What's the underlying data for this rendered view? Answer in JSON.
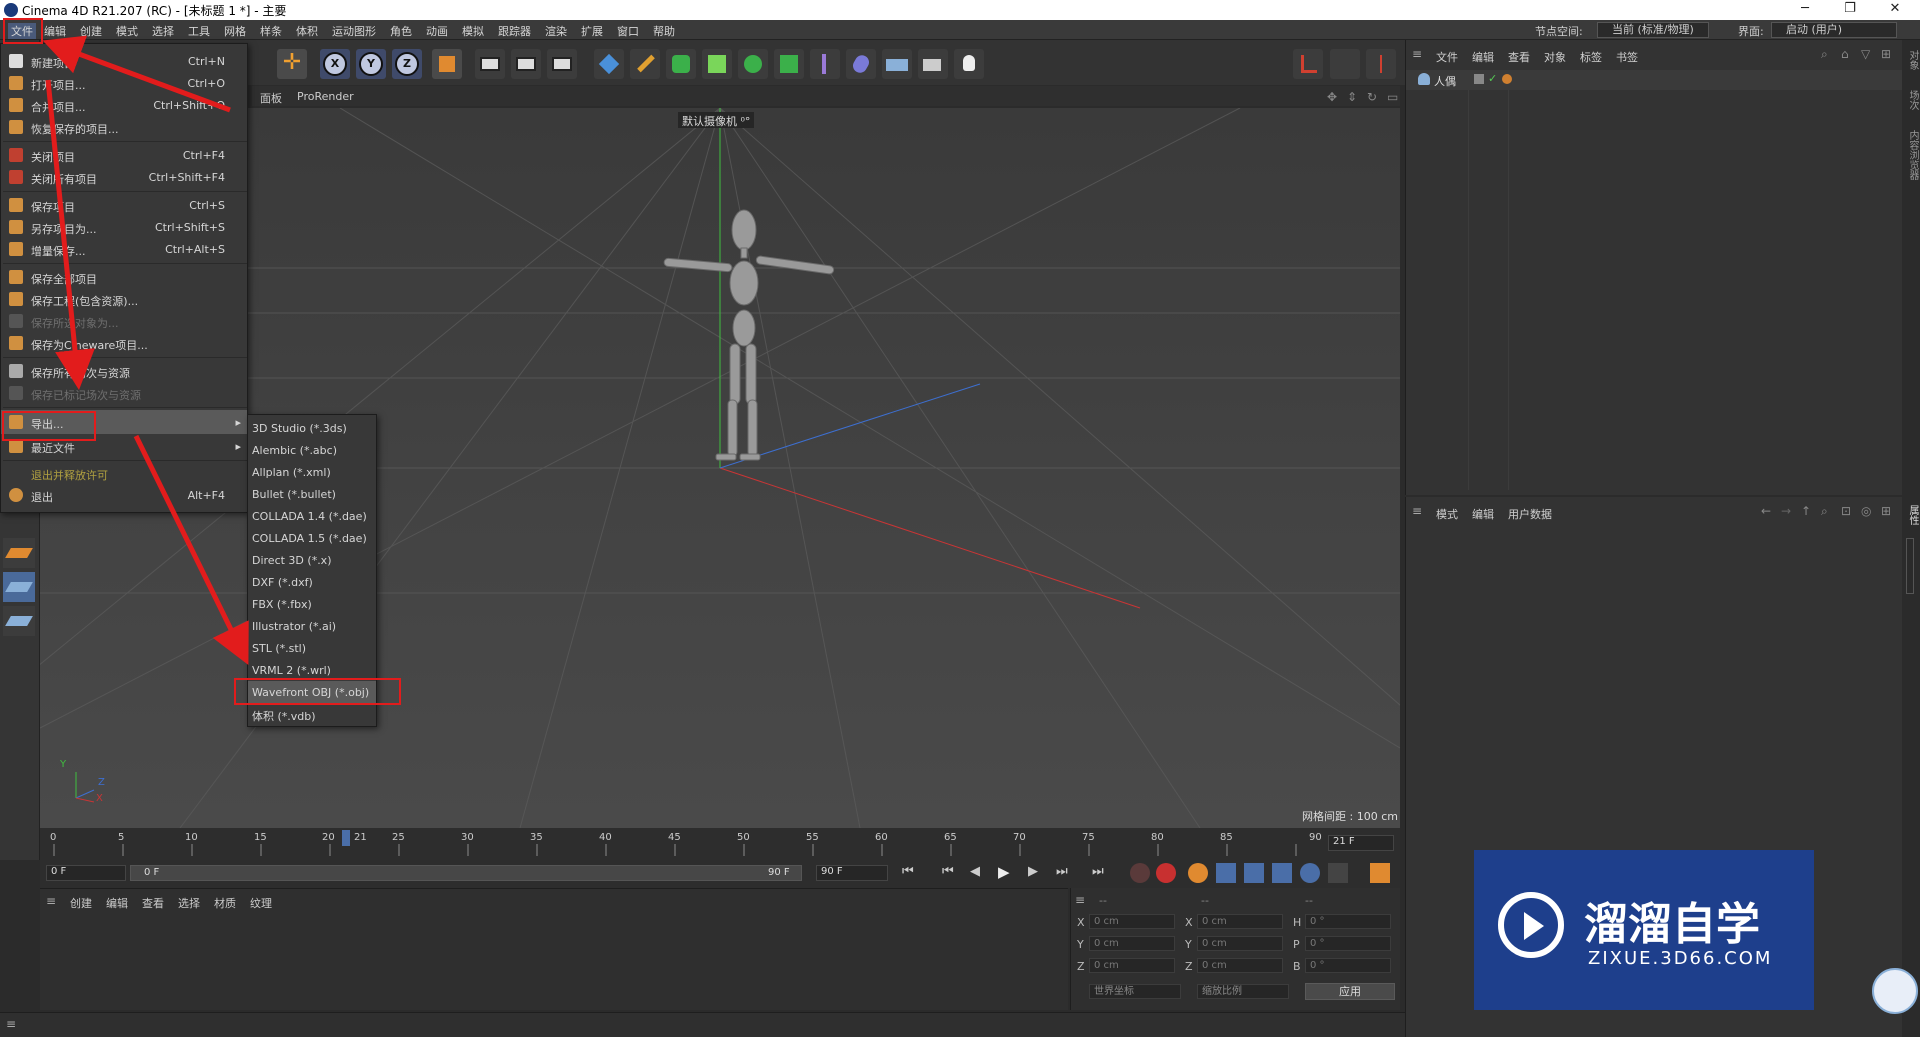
{
  "window": {
    "title": "Cinema 4D R21.207 (RC) - [未标题 1 *] - 主要",
    "controls": [
      "─",
      "❐",
      "✕"
    ]
  },
  "menubar": {
    "items": [
      "文件",
      "编辑",
      "创建",
      "模式",
      "选择",
      "工具",
      "网格",
      "样条",
      "体积",
      "运动图形",
      "角色",
      "动画",
      "模拟",
      "跟踪器",
      "渲染",
      "扩展",
      "窗口",
      "帮助"
    ],
    "node_space_label": "节点空间:",
    "node_space_value": "当前 (标准/物理)",
    "layout_label": "界面:",
    "layout_value": "启动 (用户)"
  },
  "viewport": {
    "menu": [
      "面板",
      "ProRender"
    ],
    "camera_label": "默认摄像机 ⁰°",
    "grid_spacing": "网格间距 : 100 cm"
  },
  "file_menu": {
    "items": [
      {
        "label": "新建项目",
        "shortcut": "Ctrl+N"
      },
      {
        "label": "打开项目...",
        "shortcut": "Ctrl+O"
      },
      {
        "label": "合并项目...",
        "shortcut": "Ctrl+Shift+O"
      },
      {
        "label": "恢复保存的项目...",
        "shortcut": ""
      },
      {
        "label": "关闭项目",
        "shortcut": "Ctrl+F4"
      },
      {
        "label": "关闭所有项目",
        "shortcut": "Ctrl+Shift+F4"
      },
      {
        "label": "保存项目",
        "shortcut": "Ctrl+S"
      },
      {
        "label": "另存项目为...",
        "shortcut": "Ctrl+Shift+S"
      },
      {
        "label": "增量保存...",
        "shortcut": "Ctrl+Alt+S"
      },
      {
        "label": "保存全部项目",
        "shortcut": ""
      },
      {
        "label": "保存工程(包含资源)...",
        "shortcut": ""
      },
      {
        "label": "保存所选对象为...",
        "shortcut": ""
      },
      {
        "label": "保存为Cineware项目...",
        "shortcut": ""
      },
      {
        "label": "保存所有场次与资源",
        "shortcut": ""
      },
      {
        "label": "保存已标记场次与资源",
        "shortcut": ""
      },
      {
        "label": "导出...",
        "shortcut": "▸"
      },
      {
        "label": "最近文件",
        "shortcut": "▸"
      },
      {
        "label": "退出并释放许可",
        "shortcut": ""
      },
      {
        "label": "退出",
        "shortcut": "Alt+F4"
      }
    ]
  },
  "export_menu": {
    "items": [
      "3D Studio (*.3ds)",
      "Alembic (*.abc)",
      "Allplan (*.xml)",
      "Bullet (*.bullet)",
      "COLLADA 1.4 (*.dae)",
      "COLLADA 1.5 (*.dae)",
      "Direct 3D (*.x)",
      "DXF (*.dxf)",
      "FBX (*.fbx)",
      "Illustrator (*.ai)",
      "STL (*.stl)",
      "VRML 2 (*.wrl)",
      "Wavefront OBJ (*.obj)",
      "体积 (*.vdb)"
    ],
    "highlighted": "Wavefront OBJ (*.obj)"
  },
  "timeline": {
    "ticks": [
      "0",
      "5",
      "10",
      "15",
      "20",
      "21",
      "25",
      "30",
      "35",
      "40",
      "45",
      "50",
      "55",
      "60",
      "65",
      "70",
      "75",
      "80",
      "85",
      "90"
    ],
    "current_frame": "21 F",
    "start_field": "0 F",
    "range_start": "0 F",
    "range_end": "90 F",
    "end_field": "90 F"
  },
  "material_manager": {
    "menu": [
      "创建",
      "编辑",
      "查看",
      "选择",
      "材质",
      "纹理"
    ]
  },
  "coordinates": {
    "header": [
      "--",
      "--",
      "--"
    ],
    "rows": [
      {
        "pos_label": "X",
        "pos": "0 cm",
        "size_label": "X",
        "size": "0 cm",
        "rot_label": "H",
        "rot": "0 °"
      },
      {
        "pos_label": "Y",
        "pos": "0 cm",
        "size_label": "Y",
        "size": "0 cm",
        "rot_label": "P",
        "rot": "0 °"
      },
      {
        "pos_label": "Z",
        "pos": "0 cm",
        "size_label": "Z",
        "size": "0 cm",
        "rot_label": "B",
        "rot": "0 °"
      }
    ],
    "world": "世界坐标",
    "scale": "缩放比例",
    "apply": "应用"
  },
  "object_manager": {
    "menu": [
      "文件",
      "编辑",
      "查看",
      "对象",
      "标签",
      "书签"
    ],
    "object_name": "人偶"
  },
  "attribute_manager": {
    "menu": [
      "模式",
      "编辑",
      "用户数据"
    ]
  },
  "right_tabs": [
    "对象",
    "场次",
    "内容浏览器",
    "属性"
  ],
  "watermark": {
    "brand": "溜溜自学",
    "url": "ZIXUE.3D66.COM"
  },
  "axis": {
    "y": "Y",
    "z": "Z",
    "x": "X"
  },
  "colors": {
    "highlight": "#e21c1c",
    "menu_bg": "#383838",
    "hover": "#5a5a5a",
    "watermark_bg": "#1e3f8c",
    "y_axis": "#3fbf3f",
    "x_axis": "#c93535",
    "z_axis": "#3d6fd0"
  }
}
